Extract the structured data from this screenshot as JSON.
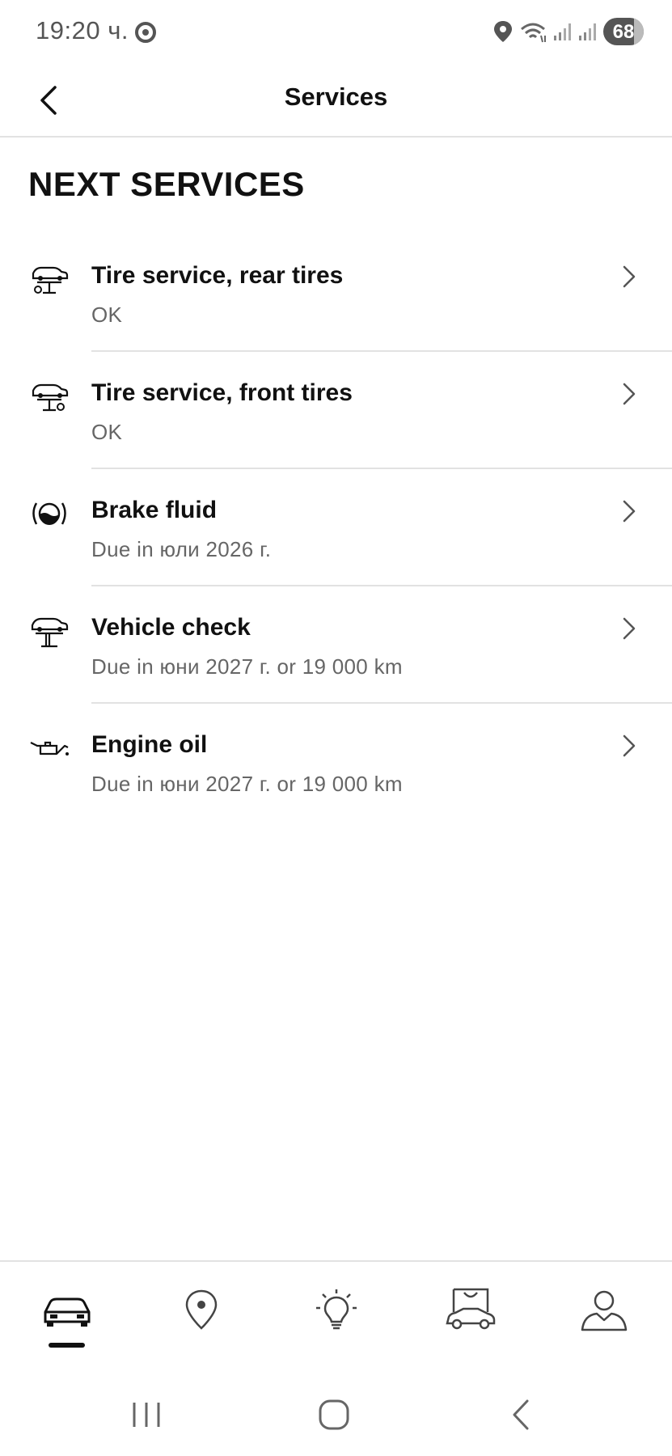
{
  "status_bar": {
    "time": "19:20 ч.",
    "battery": "68",
    "icons": [
      "chrome-icon",
      "location-icon",
      "wifi-icon",
      "signal-icon",
      "signal-icon"
    ]
  },
  "header": {
    "title": "Services",
    "back_icon": "chevron-left-icon"
  },
  "section_title": "NEXT SERVICES",
  "services": [
    {
      "name": "Tire service, rear tires",
      "status": "OK",
      "icon": "tire-service-icon"
    },
    {
      "name": "Tire service, front tires",
      "status": "OK",
      "icon": "tire-service-icon"
    },
    {
      "name": "Brake fluid",
      "status": "Due in юли 2026 г.",
      "icon": "brake-fluid-icon"
    },
    {
      "name": "Vehicle check",
      "status": "Due in юни 2027 г. or 19 000 km",
      "icon": "vehicle-lift-icon"
    },
    {
      "name": "Engine oil",
      "status": "Due in юни 2027 г. or 19 000 km",
      "icon": "oil-can-icon"
    }
  ],
  "bottom_nav": {
    "items": [
      "car-icon",
      "map-pin-icon",
      "lightbulb-icon",
      "shop-icon",
      "profile-icon"
    ],
    "active": "car-icon"
  },
  "system_nav": [
    "recents-icon",
    "home-icon",
    "back-icon"
  ]
}
